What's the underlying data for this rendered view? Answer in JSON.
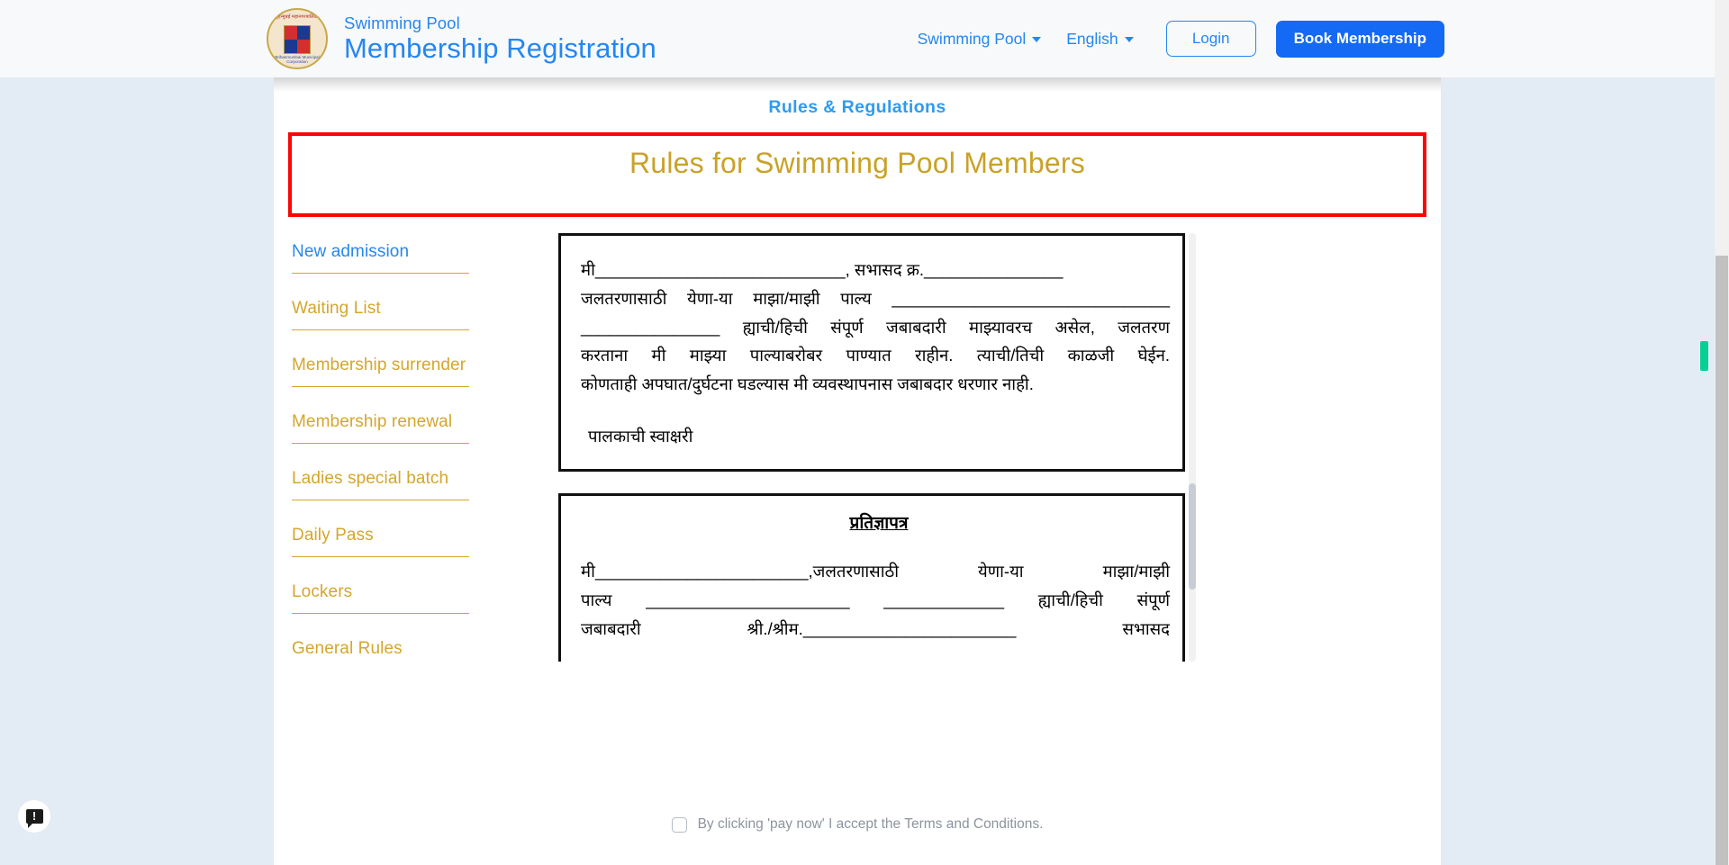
{
  "header": {
    "logo_alt": "bmc-emblem",
    "logo_arc_top": "बृहन्मुंबई महानगरपालिका",
    "logo_arc_bottom": "Brihanmumbai Municipal Corporation",
    "brand_sub": "Swimming Pool",
    "brand_title": "Membership Registration",
    "nav": {
      "pool_dropdown": "Swimming Pool",
      "language_dropdown": "English",
      "login_label": "Login",
      "book_label": "Book Membership"
    }
  },
  "page": {
    "section_title": "Rules & Regulations",
    "banner_title": "Rules for Swimming Pool Members",
    "banner_border_color": "#fb0505",
    "banner_title_color": "#c9a227",
    "accent_blue": "#2487f0",
    "accent_gold": "#d4a62c",
    "background_color": "#e3ebf5"
  },
  "sidebar": {
    "items": [
      {
        "label": "New admission",
        "active": true
      },
      {
        "label": "Waiting List",
        "active": false
      },
      {
        "label": "Membership surrender",
        "active": false
      },
      {
        "label": "Membership renewal",
        "active": false
      },
      {
        "label": "Ladies special batch",
        "active": false
      },
      {
        "label": "Daily Pass",
        "active": false
      },
      {
        "label": "Lockers",
        "active": false
      },
      {
        "label": "General Rules",
        "active": false
      }
    ]
  },
  "document": {
    "block1": {
      "line1": "मी___________________________, सभासद क्र._______________",
      "line2": "जलतरणासाठी येणा-या माझा/माझी पाल्य ______________________________",
      "line3": "_______________ ह्याची/हिची संपूर्ण जबाबदारी माझ्यावरच असेल, जलतरण",
      "line4": "करताना मी माझ्या पाल्याबरोबर पाण्यात राहीन. त्याची/तिची काळजी घेईन.",
      "line5": "कोणताही अपघात/दुर्घटना घडल्यास मी व्यवस्थापनास जबाबदार धरणार नाही.",
      "signature_label": "पालकाची स्वाक्षरी"
    },
    "block2": {
      "title": "प्रतिज्ञापत्र",
      "line1": "मी_______________________,जलतरणासाठी येणा-या    माझा/माझी",
      "line2": "पाल्य  ______________________  _____________ ह्याची/हिची  संपूर्ण",
      "line3": "जबाबदारी        श्री./श्रीम._______________________            सभासद"
    }
  },
  "consent": {
    "text": "By clicking 'pay now' I accept the Terms and Conditions.",
    "checked": false
  },
  "feedback": {
    "icon": "feedback-alert-icon",
    "glyph": "!"
  }
}
